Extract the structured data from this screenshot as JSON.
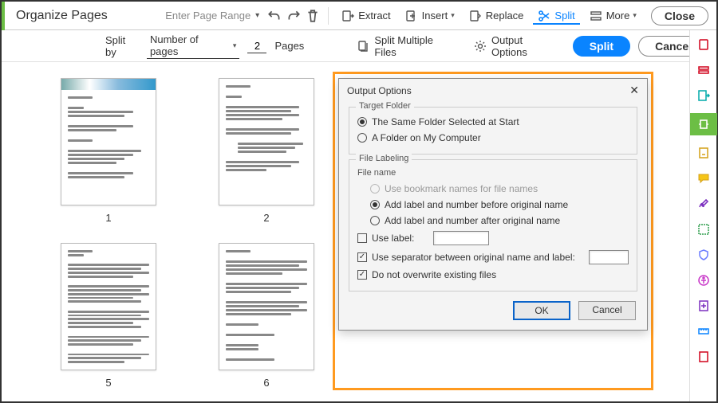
{
  "topbar": {
    "title": "Organize Pages",
    "page_range_label": "Enter Page Range",
    "extract_label": "Extract",
    "insert_label": "Insert",
    "replace_label": "Replace",
    "split_label": "Split",
    "more_label": "More",
    "close_label": "Close"
  },
  "subbar": {
    "split_by_label": "Split by",
    "split_mode": "Number of pages",
    "pages_value": "2",
    "pages_label": "Pages",
    "split_multiple_label": "Split Multiple Files",
    "output_options_label": "Output Options",
    "split_btn": "Split",
    "cancel_btn": "Cancel"
  },
  "thumbs": {
    "p1": "1",
    "p2": "2",
    "p5": "5",
    "p6": "6"
  },
  "dialog": {
    "title": "Output Options",
    "target_folder_title": "Target Folder",
    "target_same": "The Same Folder Selected at Start",
    "target_computer": "A Folder on My Computer",
    "file_labeling_title": "File Labeling",
    "file_name_title": "File name",
    "opt_bookmark": "Use bookmark names for file names",
    "opt_before": "Add label and number before original name",
    "opt_after": "Add label and number after original name",
    "use_label": "Use label:",
    "use_separator": "Use separator between original name and label:",
    "no_overwrite": "Do not overwrite existing files",
    "ok": "OK",
    "cancel": "Cancel"
  }
}
